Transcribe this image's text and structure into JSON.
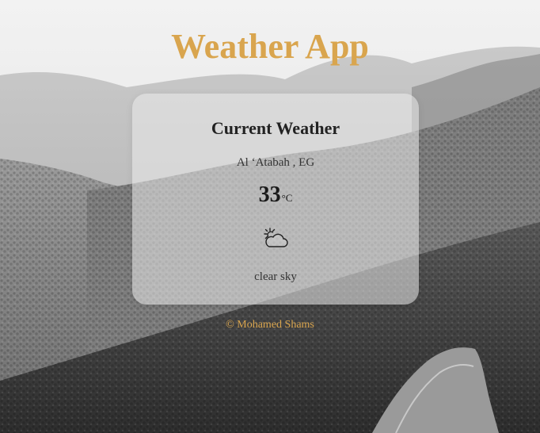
{
  "app": {
    "title": "Weather App"
  },
  "weather_card": {
    "heading": "Current Weather",
    "location": "Al ʻAtabah , EG",
    "temperature": "33",
    "unit": "°C",
    "condition_icon": "partly-cloudy-sun-icon",
    "description": "clear sky"
  },
  "footer": {
    "credit": "© Mohamed Shams"
  },
  "colors": {
    "accent": "#d9a54e",
    "card_bg": "rgba(235,235,235,0.55)",
    "text_dark": "#222222"
  }
}
